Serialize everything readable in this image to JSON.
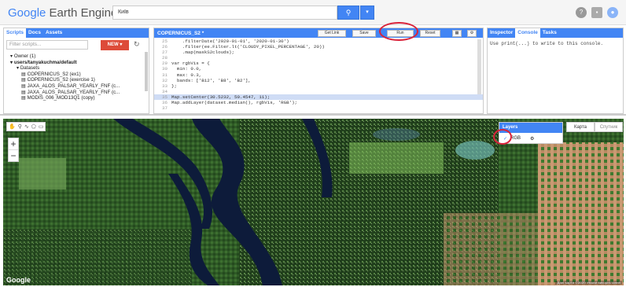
{
  "header": {
    "logo_google": "Google",
    "logo_rest": "Earth Engine",
    "search_value": "Київ",
    "search_icon": "search-icon",
    "help_icon": "help-icon",
    "feedback_icon": "feedback-icon",
    "account_icon": "account-icon"
  },
  "left_panel": {
    "tabs": [
      "Scripts",
      "Docs",
      "Assets"
    ],
    "filter_placeholder": "Filter scripts...",
    "new_label": "NEW ▾",
    "tree": [
      "▾ Owner (1)",
      "▾ users/tanyakuchma/default",
      "▾ Datasets",
      "▤ COPERNICUS_S2 (ex1)",
      "▤ COPERNICUS_S2 (exercise 1)",
      "▤ JAXA_ALOS_PALSAR_YEARLY_FNF (c...",
      "▤ JAXA_ALOS_PALSAR_YEARLY_FNF (c...",
      "▤ MODIS_006_MOD13Q1 (copy)"
    ]
  },
  "editor": {
    "title": "COPERNICUS_S2 *",
    "buttons": {
      "get_link": "Get Link",
      "save": "Save",
      "run": "Run",
      "reset": "Reset"
    },
    "lines": [
      {
        "n": "25",
        "text": "    .filterDate('2020-01-01', '2020-01-30')"
      },
      {
        "n": "26",
        "text": "    .filter(ee.Filter.lt('CLOUDY_PIXEL_PERCENTAGE', 20))"
      },
      {
        "n": "27",
        "text": "    .map(maskS2clouds);"
      },
      {
        "n": "28",
        "text": ""
      },
      {
        "n": "29",
        "text": "var rgbVis = {"
      },
      {
        "n": "30",
        "text": "  min: 0.0,"
      },
      {
        "n": "31",
        "text": "  max: 0.3,"
      },
      {
        "n": "32",
        "text": "  bands: ['B12', 'B8', 'B2'],"
      },
      {
        "n": "33",
        "text": "};"
      },
      {
        "n": "34",
        "text": ""
      },
      {
        "n": "35",
        "text": "Map.setCenter(30.5232, 50.4547, 11);"
      },
      {
        "n": "36",
        "text": "Map.addLayer(dataset.median(), rgbVis, 'RGB');"
      },
      {
        "n": "37",
        "text": ""
      }
    ]
  },
  "right_panel": {
    "tabs": [
      "Inspector",
      "Console",
      "Tasks"
    ],
    "console_text": "Use print(...) to write to this console."
  },
  "map": {
    "tools": [
      "✋",
      "⚲",
      "∿",
      "⬠",
      "▭"
    ],
    "zoom_in": "+",
    "zoom_out": "−",
    "layers_title": "Layers",
    "layer_name": "RGB",
    "map_type_1": "Карта",
    "map_type_2": "Спутник",
    "google_label": "Google",
    "attribution": "Дані карти ©2020  Умови використання"
  },
  "colors": {
    "accent": "#4285f4",
    "new_button": "#dd4b39",
    "highlight": "#d9233b"
  }
}
